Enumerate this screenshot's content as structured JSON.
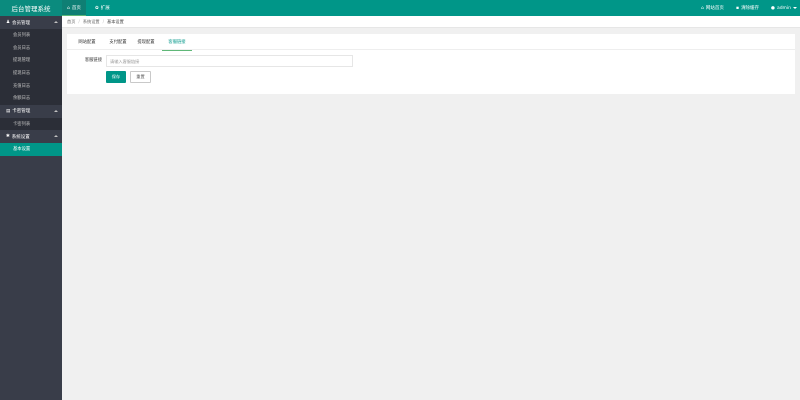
{
  "app": {
    "title": "后台管理系统"
  },
  "header": {
    "nav": [
      {
        "label": "首页",
        "icon": "home-icon"
      },
      {
        "label": "扩展",
        "icon": "tools-icon"
      }
    ],
    "right": [
      {
        "label": "网站首页",
        "icon": "home-icon"
      },
      {
        "label": "清除缓存",
        "icon": "trash-icon"
      },
      {
        "label": "admin",
        "icon": "user-icon"
      }
    ]
  },
  "sidebar": {
    "groups": [
      {
        "title": "会员管理",
        "icon": "users-icon",
        "items": [
          "会员列表",
          "会员日志",
          "提现管理",
          "提现日志",
          "充值日志",
          "余额日志"
        ]
      },
      {
        "title": "卡密管理",
        "icon": "card-icon",
        "items": [
          "卡密列表"
        ]
      },
      {
        "title": "系统设置",
        "icon": "gear-icon",
        "items": [
          "基本设置"
        ]
      }
    ]
  },
  "breadcrumb": {
    "items": [
      "首页",
      "系统设置",
      "基本设置"
    ]
  },
  "tabs": [
    "网站配置",
    "支付配置",
    "提现配置",
    "客服链接"
  ],
  "form": {
    "label": "客服链接",
    "placeholder": "请输入客服链接",
    "value": "",
    "save_label": "保存",
    "reset_label": "重置"
  },
  "colors": {
    "accent": "#009688",
    "sidebar_bg": "#393d49",
    "tab_indicator": "#5fb878"
  }
}
